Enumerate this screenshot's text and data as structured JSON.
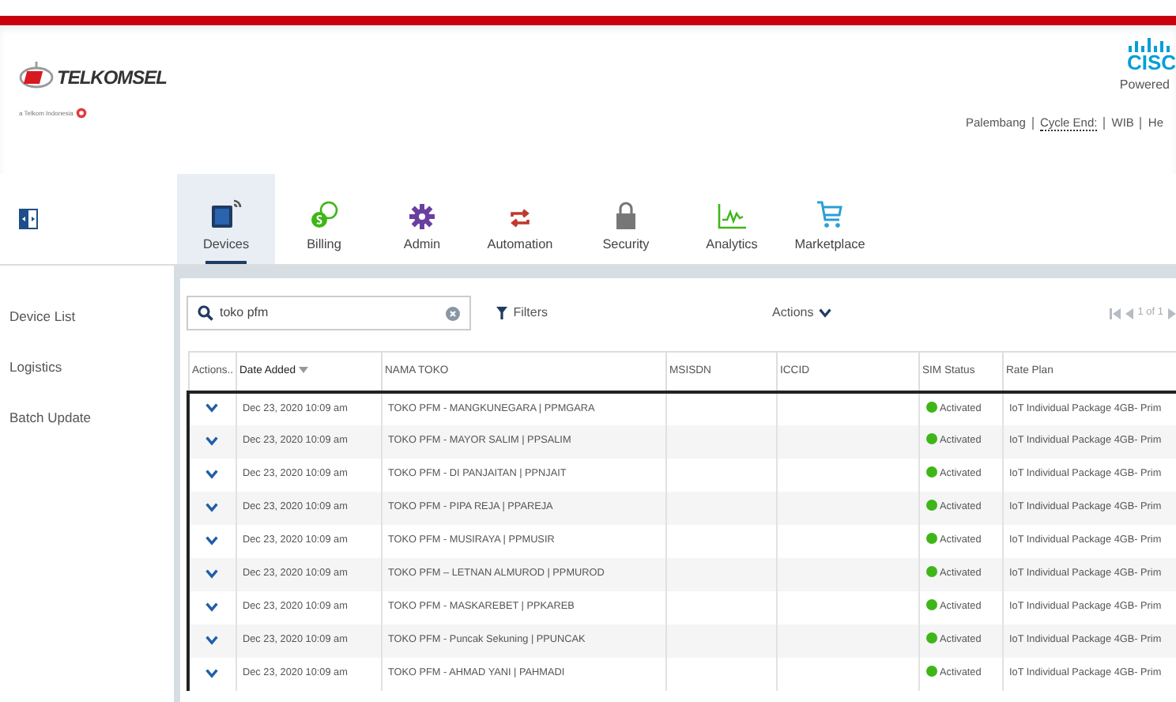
{
  "header": {
    "logo_text": "TELKOMSEL",
    "logo_tagline": "a Telkom Indonesia",
    "partner_logo": "CISC",
    "partner_caption": "Powered",
    "links": [
      {
        "label": "Palembang",
        "dotted": false
      },
      {
        "label": "Cycle End:",
        "dotted": true
      },
      {
        "label": "WIB",
        "dotted": false
      },
      {
        "label": "He",
        "dotted": false
      }
    ]
  },
  "nav_tabs": [
    {
      "label": "Devices",
      "selected": true
    },
    {
      "label": "Billing",
      "selected": false
    },
    {
      "label": "Admin",
      "selected": false
    },
    {
      "label": "Automation",
      "selected": false
    },
    {
      "label": "Security",
      "selected": false
    },
    {
      "label": "Analytics",
      "selected": false
    },
    {
      "label": "Marketplace",
      "selected": false
    }
  ],
  "sidebar": {
    "items": [
      {
        "label": "Device List",
        "selected": false
      },
      {
        "label": "Logistics",
        "selected": false
      },
      {
        "label": "Batch Update",
        "selected": false
      }
    ]
  },
  "toolbar": {
    "search": {
      "value": "toko pfm"
    },
    "filters": "Filters",
    "actions": "Actions",
    "pager": "1 of 1"
  },
  "table": {
    "columns": [
      {
        "label": "Actions..",
        "sorted": false
      },
      {
        "label": "Date Added",
        "sorted": true
      },
      {
        "label": "NAMA TOKO",
        "sorted": false
      },
      {
        "label": "MSISDN",
        "sorted": false
      },
      {
        "label": "ICCID",
        "sorted": false
      },
      {
        "label": "SIM Status",
        "sorted": false
      },
      {
        "label": "Rate Plan",
        "sorted": false
      }
    ],
    "rows": [
      {
        "date": "Dec 23, 2020 10:09 am",
        "name": "TOKO PFM - MANGKUNEGARA | PPMGARA",
        "status": "Activated",
        "color": "#3fb618",
        "rate_plan": "IoT Individual Package 4GB- Prim"
      },
      {
        "date": "Dec 23, 2020 10:09 am",
        "name": "TOKO PFM - MAYOR SALIM | PPSALIM",
        "status": "Activated",
        "color": "#3fb618",
        "rate_plan": "IoT Individual Package 4GB- Prim"
      },
      {
        "date": "Dec 23, 2020 10:09 am",
        "name": "TOKO PFM - DI PANJAITAN | PPNJAIT",
        "status": "Activated",
        "color": "#3fb618",
        "rate_plan": "IoT Individual Package 4GB- Prim"
      },
      {
        "date": "Dec 23, 2020 10:09 am",
        "name": "TOKO PFM - PIPA REJA | PPAREJA",
        "status": "Activated",
        "color": "#3fb618",
        "rate_plan": "IoT Individual Package 4GB- Prim"
      },
      {
        "date": "Dec 23, 2020 10:09 am",
        "name": "TOKO PFM - MUSIRAYA | PPMUSIR",
        "status": "Activated",
        "color": "#3fb618",
        "rate_plan": "IoT Individual Package 4GB- Prim"
      },
      {
        "date": "Dec 23, 2020 10:09 am",
        "name": "TOKO PFM – LETNAN ALMUROD | PPMUROD",
        "status": "Activated",
        "color": "#3fb618",
        "rate_plan": "IoT Individual Package 4GB- Prim"
      },
      {
        "date": "Dec 23, 2020 10:09 am",
        "name": "TOKO PFM - MASKAREBET | PPKAREB",
        "status": "Activated",
        "color": "#3fb618",
        "rate_plan": "IoT Individual Package 4GB- Prim"
      },
      {
        "date": "Dec 23, 2020 10:09 am",
        "name": "TOKO PFM - Puncak Sekuning | PPUNCAK",
        "status": "Activated",
        "color": "#3fb618",
        "rate_plan": "IoT Individual Package 4GB- Prim"
      },
      {
        "date": "Dec 23, 2020 10:09 am",
        "name": "TOKO PFM - AHMAD YANI | PAHMADI",
        "status": "Activated",
        "color": "#3fb618",
        "rate_plan": "IoT Individual Package 4GB- Prim"
      }
    ]
  }
}
